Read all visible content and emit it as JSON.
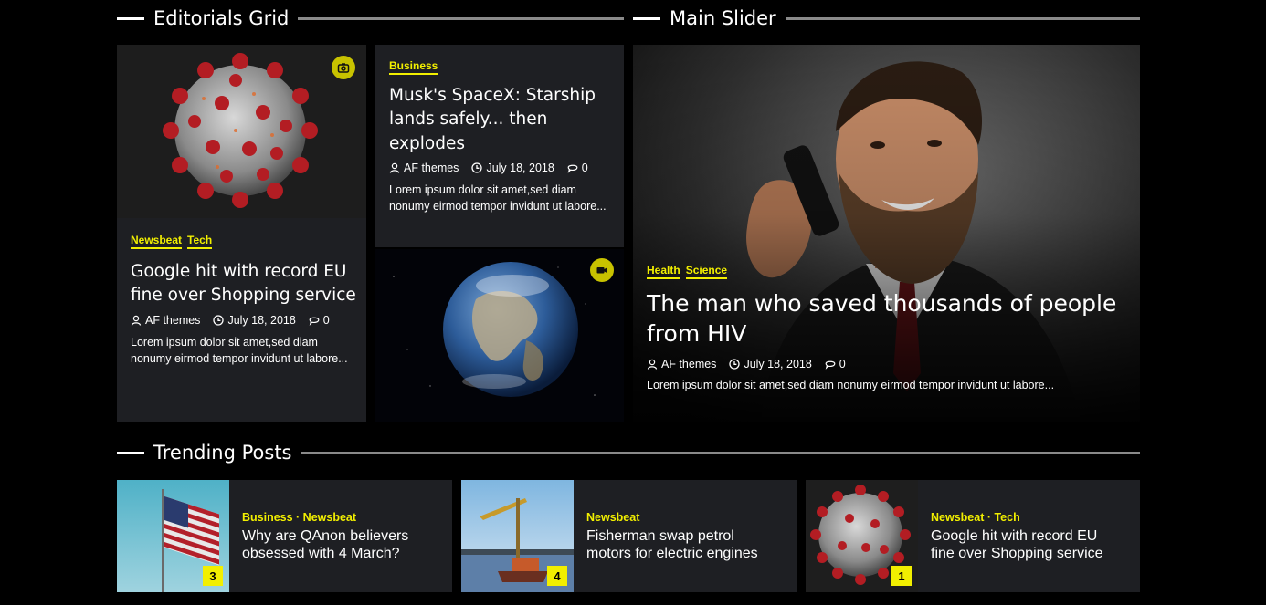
{
  "sections": {
    "editorials": "Editorials Grid",
    "main_slider": "Main Slider",
    "trending": "Trending Posts"
  },
  "editorials": {
    "left": {
      "categories": [
        "Newsbeat",
        "Tech"
      ],
      "title": "Google hit with record EU fine over Shopping service",
      "author": "AF themes",
      "date": "July 18, 2018",
      "comments": "0",
      "excerpt": "Lorem ipsum dolor sit amet,sed diam nonumy eirmod tempor invidunt ut labore...",
      "badge_icon": "camera-icon"
    },
    "top_right": {
      "category": "Business",
      "title": "Musk's SpaceX: Starship lands safely... then explodes",
      "author": "AF themes",
      "date": "July 18, 2018",
      "comments": "0",
      "excerpt": "Lorem ipsum dolor sit amet,sed diam nonumy eirmod tempor invidunt ut labore..."
    },
    "bottom_right": {
      "badge_icon": "video-icon"
    }
  },
  "slider": {
    "categories": [
      "Health",
      "Science"
    ],
    "title": "The man who saved thousands of people from HIV",
    "author": "AF themes",
    "date": "July 18, 2018",
    "comments": "0",
    "excerpt": "Lorem ipsum dolor sit amet,sed diam nonumy eirmod tempor invidunt ut labore..."
  },
  "trending": [
    {
      "categories": "Business · Newsbeat",
      "title": "Why are QAnon believers obsessed with 4 March?",
      "rank": "3"
    },
    {
      "categories": "Newsbeat",
      "title": "Fisherman swap petrol motors for electric engines",
      "rank": "4"
    },
    {
      "categories": "Newsbeat · Tech",
      "title": "Google hit with record EU fine over Shopping service",
      "rank": "1"
    }
  ],
  "colors": {
    "accent": "#f2ef00",
    "card_bg": "#1e1f23",
    "badge": "#c8c200"
  }
}
